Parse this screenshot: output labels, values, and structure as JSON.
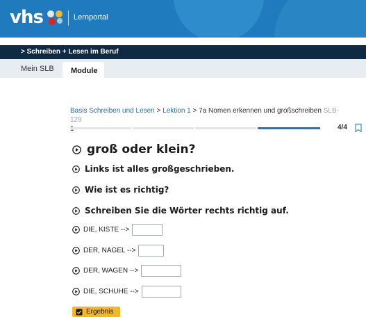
{
  "header": {
    "logo": "vhs",
    "portal_label": "Lernportal",
    "brand_color": "#1f7bbd"
  },
  "nav": {
    "section": "> Schreiben + Lesen im Beruf",
    "bg_color": "#0f2a44"
  },
  "tabs": [
    {
      "label": "Mein SLB",
      "active": false
    },
    {
      "label": "Module",
      "active": true
    }
  ],
  "breadcrumb": {
    "items": [
      "Basis Schreiben und Lesen",
      "Lektion 1",
      "7a Nomen erkennen und großschreiben"
    ],
    "separator": " > ",
    "code": "SLB-129",
    "code_suffix": "1"
  },
  "progress": {
    "current": 4,
    "total": 4,
    "label": "4/4",
    "active_segment": 4
  },
  "exercise": {
    "title": "groß oder klein?",
    "instructions": [
      "Links ist alles großgeschrieben.",
      "Wie ist es richtig?",
      "Schreiben Sie die Wörter rechts richtig auf."
    ],
    "items": [
      {
        "prompt": "DIE, KISTE -->",
        "value": ""
      },
      {
        "prompt": "DER, NAGEL -->",
        "value": ""
      },
      {
        "prompt": "DER, WAGEN -->",
        "value": ""
      },
      {
        "prompt": "DIE, SCHUHE -->",
        "value": ""
      }
    ]
  },
  "result_button": {
    "label": "Ergebnis",
    "color": "#f3b72a"
  },
  "icons": {
    "play": "play-circle-icon",
    "bookmark": "bookmark-icon",
    "check": "checkbox-icon"
  }
}
